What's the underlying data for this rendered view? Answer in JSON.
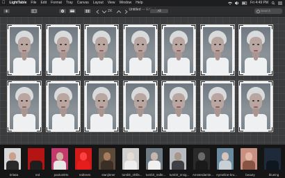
{
  "menubar": {
    "app_name": "LightTable",
    "items": [
      "File",
      "Edit",
      "Format",
      "Tray",
      "Canvas",
      "Layout",
      "View",
      "Window",
      "Help"
    ],
    "clock": "Fri 4:49 PM"
  },
  "toolbar": {
    "title": "Untitled",
    "subtitle": "— Edited",
    "zoom_label": "2X",
    "all_label": "All",
    "search_placeholder": "Search"
  },
  "canvas": {
    "rows": 2,
    "columns": 7,
    "card_label": "portrait"
  },
  "strip": {
    "trays": [
      {
        "label": "tiritata",
        "bg": "#d8d8d8",
        "face": "#c9a08a",
        "body": "#2a2a2a"
      },
      {
        "label": "red",
        "bg": "#b51414",
        "face": "#b51414",
        "body": "#1e1e1e"
      },
      {
        "label": "paolumlrts",
        "bg": "#c23a6b",
        "face": "#d0b0a0",
        "body": "#e6e6e6"
      },
      {
        "label": "redtrees",
        "bg": "#d11a1a",
        "face": "#ff4040",
        "body": "#e61d1d"
      },
      {
        "label": "stanjitmer",
        "bg": "#5a4a3a",
        "face": "#a87c5c",
        "body": "#3a2e26"
      },
      {
        "label": "tumblr_nhllis...",
        "bg": "#cfcfcf",
        "face": "#e6dcd6",
        "body": "#eeeeee"
      },
      {
        "label": "tumblr_mdle...",
        "bg": "#6d7c84",
        "face": "#c8b6ae",
        "body": "#f0f0f0"
      },
      {
        "label": "tumblr_nrxig...",
        "bg": "#b8bcc0",
        "face": "#a8968a",
        "body": "#3e4046"
      },
      {
        "label": "Amsterdamle...",
        "bg": "#2a2a2a",
        "face": "#6a6a6a",
        "body": "#1a1a1a"
      },
      {
        "label": "Aymeline-bru...",
        "bg": "#6a8aa0",
        "face": "#d8c4b8",
        "body": "#c8d0d6"
      },
      {
        "label": "beauty",
        "bg": "#c89080",
        "face": "#e2b8a4",
        "body": "#8a5444"
      },
      {
        "label": "blueing",
        "bg": "#1e2a3a",
        "face": "#1e2a3a",
        "body": "#0e1620"
      }
    ]
  }
}
